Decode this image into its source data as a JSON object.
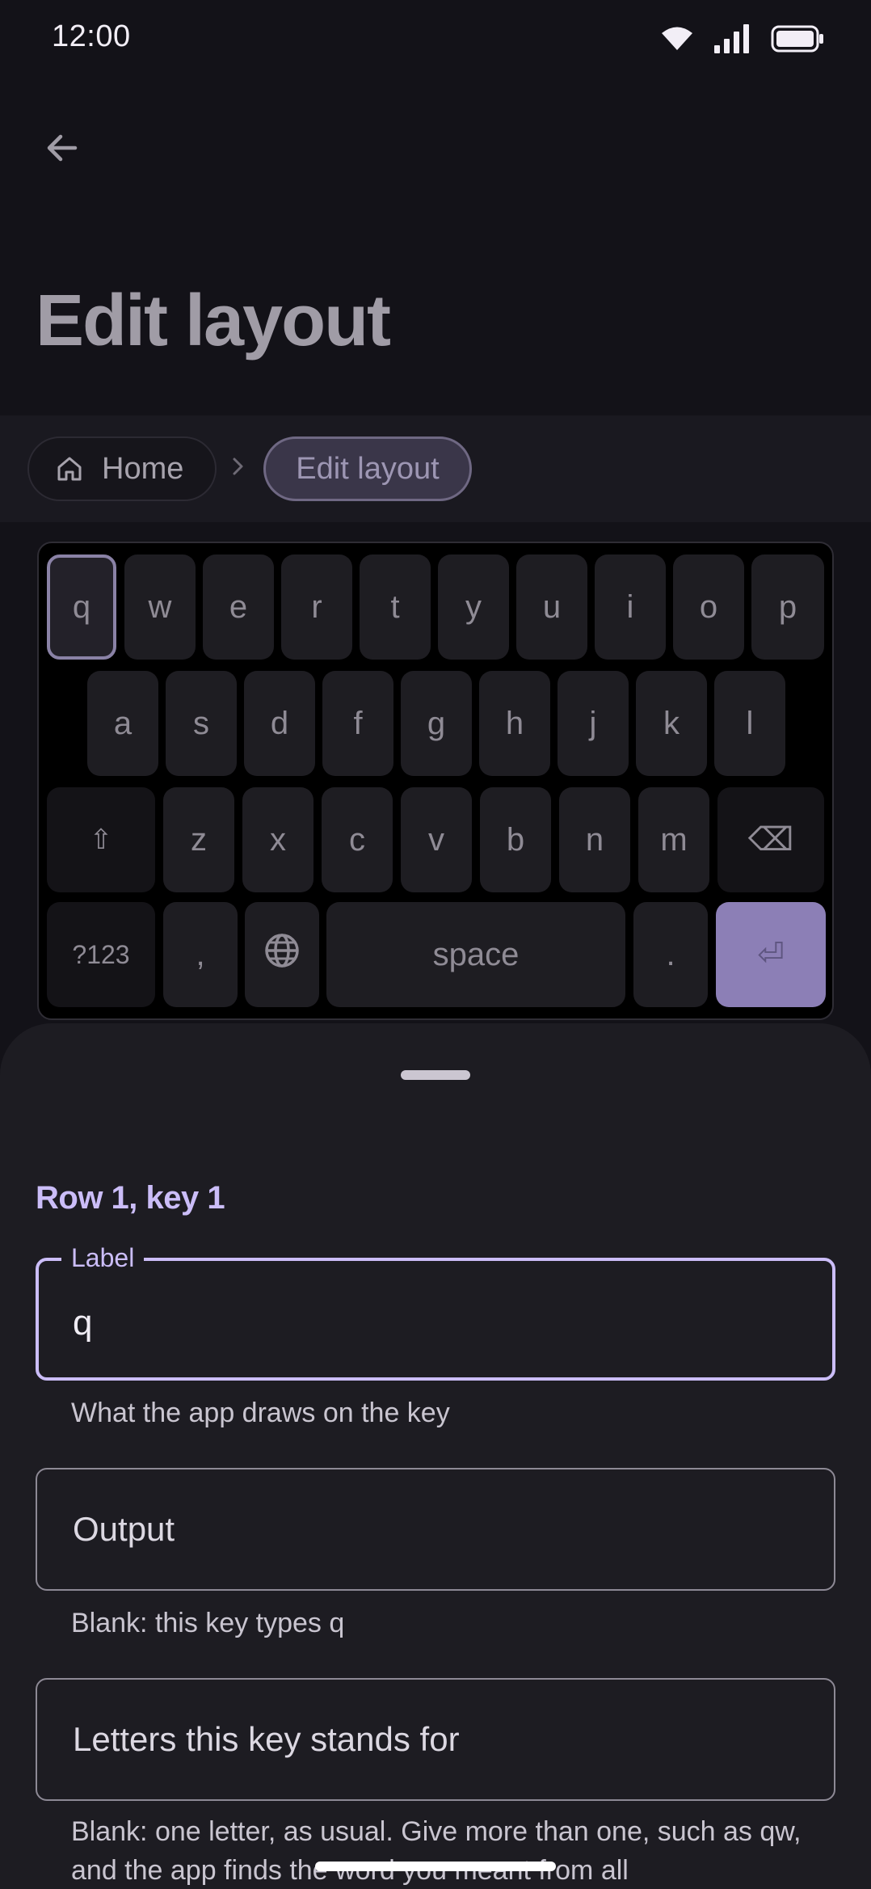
{
  "status_bar": {
    "time": "12:00",
    "icons": [
      "wifi-icon",
      "signal-icon",
      "battery-icon"
    ]
  },
  "app_bar": {
    "back_icon": "arrow-back-icon",
    "title": "Edit layout"
  },
  "breadcrumb": {
    "home_label": "Home",
    "home_icon": "home-icon",
    "separator_icon": "chevron-right-icon",
    "current_label": "Edit layout"
  },
  "keyboard": {
    "row1": [
      "q",
      "w",
      "e",
      "r",
      "t",
      "y",
      "u",
      "i",
      "o",
      "p"
    ],
    "row2": [
      "a",
      "s",
      "d",
      "f",
      "g",
      "h",
      "j",
      "k",
      "l"
    ],
    "row3": {
      "shift": "⇧",
      "letters": [
        "z",
        "x",
        "c",
        "v",
        "b",
        "n",
        "m"
      ],
      "backspace": "⌫"
    },
    "row4": {
      "symbols": "?123",
      "comma": ",",
      "globe_icon": "globe-icon",
      "space": "space",
      "period": ".",
      "enter": "⏎"
    },
    "selected_key": "q"
  },
  "sheet": {
    "heading": "Row 1, key 1",
    "label_field": {
      "legend": "Label",
      "value": "q",
      "helper": "What the app draws on the key"
    },
    "output_field": {
      "placeholder": "Output",
      "helper": "Blank: this key types q"
    },
    "letters_field": {
      "placeholder": "Letters this key stands for",
      "helper": "Blank: one letter, as usual. Give more than one, such as qw, and the app finds the word you meant from all"
    }
  },
  "colors": {
    "background": "#131218",
    "accent": "#cbbdf8",
    "enter_key": "#8c7fb6",
    "sheet": "#1d1c22"
  }
}
